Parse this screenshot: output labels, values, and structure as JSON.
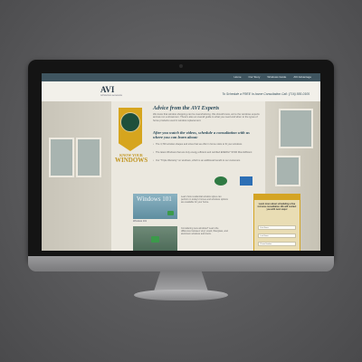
{
  "nav": {
    "items": [
      "Home",
      "Our Story",
      "Windows Guide",
      "AVI Advantage"
    ]
  },
  "header": {
    "logo_text": "AVI",
    "logo_sub": "WINDOWS & DOORS",
    "callout": "To Schedule a FREE In-home Consultation Call: (716) 555-0105"
  },
  "main": {
    "title": "Advice from the AVI Experts",
    "intro": "We know that window shopping can be overwhelming. We should know, we're the windows experts and we run a showroom. There's also an overall guide to what you need and when to the types of home products used in window replacement.",
    "subtitle": "After you watch the videos, schedule a consultation with us where you can learn about:",
    "bullets": [
      "The 3,700 window shapes and sizes that we offer in home visits to fit your windows",
      "The latest Windows that are truly energy-efficient and certified ENERGY STAR Most Efficient",
      "Our \"Triple Warranty\" on windows, which is an additional benefit to our customers"
    ]
  },
  "badge": {
    "line1": "KNOW YOUR",
    "line2": "WINDOWS"
  },
  "videos": [
    {
      "title": "Windows 101",
      "caption": "Windows 101",
      "description": "Learn how residential window styles can perform in today's homes and windows options are available for your home."
    },
    {
      "title": "",
      "caption": "",
      "description": "Considering new windows? Learn the difference between vinyl, wood, fiberglass, and aluminum windows and doors."
    }
  ],
  "form": {
    "title": "Learn more about scheduling a free in-home consultation. We will contact you with next steps!",
    "fields": [
      "First Name",
      "Last Name",
      "Phone Number"
    ]
  },
  "colors": {
    "nav": "#3f5560",
    "accent": "#d4a424",
    "heading": "#2a4a5a"
  }
}
